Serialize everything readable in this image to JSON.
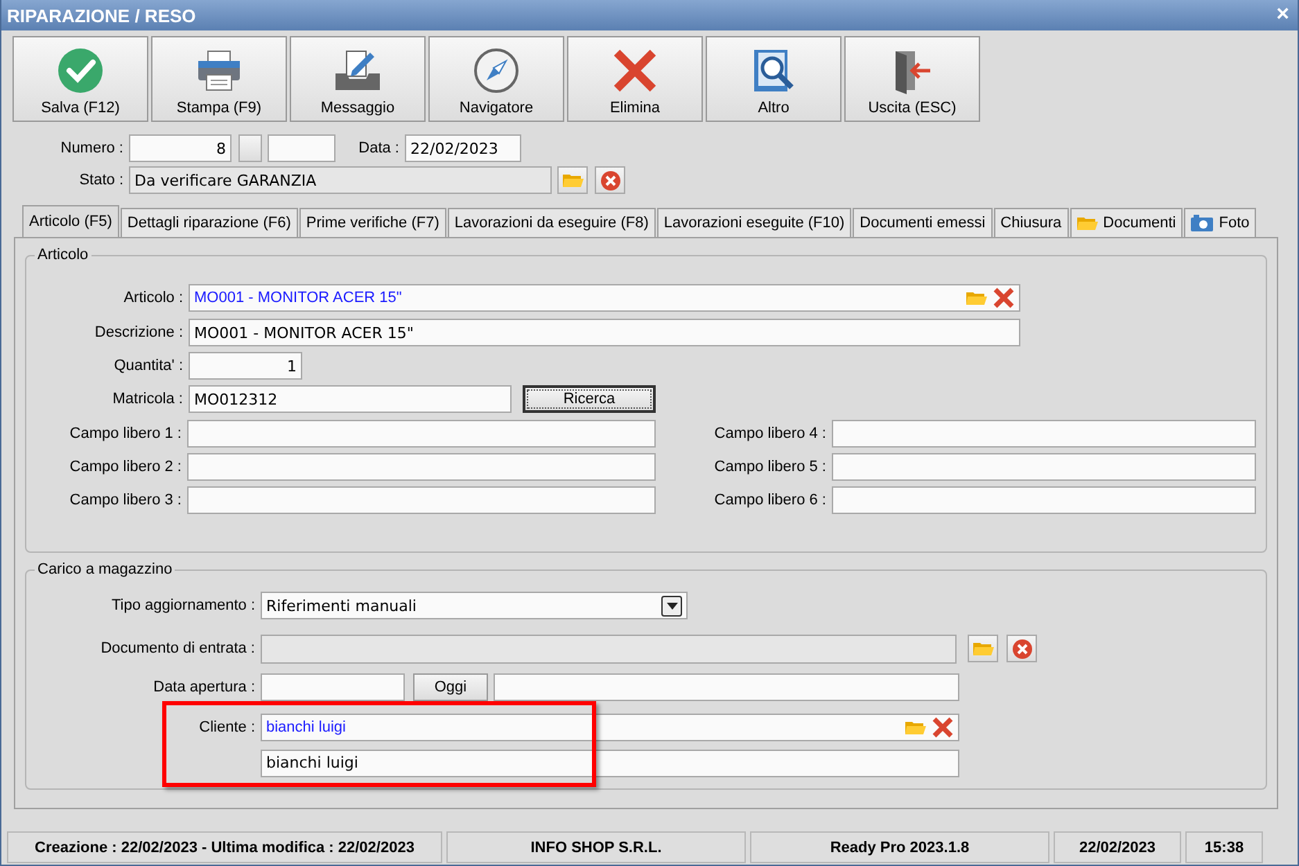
{
  "window": {
    "title": "RIPARAZIONE / RESO",
    "close": "×"
  },
  "toolbar": [
    {
      "label": "Salva (F12)",
      "kind": "check"
    },
    {
      "label": "Stampa (F9)",
      "kind": "printer"
    },
    {
      "label": "Messaggio",
      "kind": "message"
    },
    {
      "label": "Navigatore",
      "kind": "compass"
    },
    {
      "label": "Elimina",
      "kind": "cross"
    },
    {
      "label": "Altro",
      "kind": "book"
    },
    {
      "label": "Uscita (ESC)",
      "kind": "exit"
    }
  ],
  "header": {
    "numero": {
      "label": "Numero :",
      "value": "8"
    },
    "data": {
      "label": "Data :",
      "value": "22/02/2023"
    },
    "stato": {
      "label": "Stato :",
      "value": "Da verificare GARANZIA"
    }
  },
  "tabs": [
    {
      "label": "Articolo (F5)",
      "selected": true,
      "kind": "plain"
    },
    {
      "label": "Dettagli riparazione (F6)",
      "selected": false,
      "kind": "plain"
    },
    {
      "label": "Prime verifiche (F7)",
      "selected": false,
      "kind": "plain"
    },
    {
      "label": "Lavorazioni da eseguire (F8)",
      "selected": false,
      "kind": "plain"
    },
    {
      "label": "Lavorazioni eseguite  (F10)",
      "selected": false,
      "kind": "plain"
    },
    {
      "label": "Documenti emessi",
      "selected": false,
      "kind": "plain"
    },
    {
      "label": "Chiusura",
      "selected": false,
      "kind": "plain"
    },
    {
      "label": "Documenti",
      "selected": false,
      "kind": "folder"
    },
    {
      "label": "Foto",
      "selected": false,
      "kind": "camera"
    }
  ],
  "articolo": {
    "title": "Articolo",
    "articolo": {
      "label": "Articolo :",
      "value": "MO001 - MONITOR ACER 15\""
    },
    "descrizione": {
      "label": "Descrizione :",
      "value": "MO001 - MONITOR ACER 15\""
    },
    "quantita": {
      "label": "Quantita' :",
      "value": "1"
    },
    "matricola": {
      "label": "Matricola :",
      "value": "MO012312",
      "button": "Ricerca"
    },
    "campi_liberi": [
      {
        "label": "Campo libero 1 :"
      },
      {
        "label": "Campo libero 2 :"
      },
      {
        "label": "Campo libero 3 :"
      },
      {
        "label": "Campo libero 4 :"
      },
      {
        "label": "Campo libero 5 :"
      },
      {
        "label": "Campo libero 6 :"
      }
    ]
  },
  "carico": {
    "title": "Carico a magazzino",
    "tipo_aggiornamento": {
      "label": "Tipo aggiornamento :",
      "value": "Riferimenti manuali"
    },
    "documento_entrata": {
      "label": "Documento di entrata :",
      "disabled": true
    },
    "data_apertura": {
      "label": "Data apertura :",
      "button": "Oggi"
    },
    "cliente": {
      "label": "Cliente :",
      "value": "bianchi luigi",
      "description": "bianchi luigi",
      "highlighted": true
    }
  },
  "status_bar": [
    "Creazione : 22/02/2023 - Ultima modifica : 22/02/2023",
    "INFO SHOP S.R.L.",
    "Ready Pro 2023.1.8",
    "22/02/2023",
    "15:38"
  ]
}
